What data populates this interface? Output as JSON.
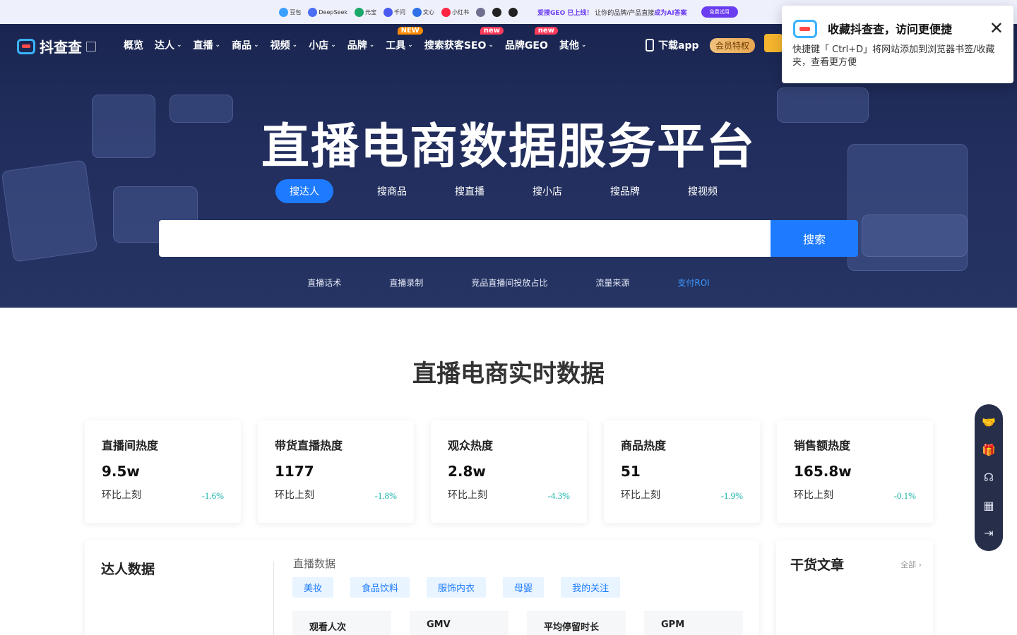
{
  "promo": {
    "ai_chips": [
      {
        "name": "豆包",
        "color": "#3aa0ff"
      },
      {
        "name": "DeepSeek",
        "color": "#4c6ef5"
      },
      {
        "name": "元宝",
        "color": "#1aa86b"
      },
      {
        "name": "千问",
        "color": "#4a5cf0"
      },
      {
        "name": "文心",
        "color": "#2f6fe8"
      },
      {
        "name": "小红书",
        "color": "#ff2442"
      },
      {
        "name": "",
        "color": "#6f6f8f"
      },
      {
        "name": "",
        "color": "#222222"
      },
      {
        "name": "",
        "color": "#222222"
      }
    ],
    "headline_highlight": "爱搜GEO 已上线！",
    "headline_rest": "让你的品牌/产品直接",
    "headline_em": "成为AI答案",
    "trial_label": "免费试用"
  },
  "nav": {
    "logo_text": "抖查查",
    "items": [
      {
        "label": "概览",
        "chevron": false,
        "badge": ""
      },
      {
        "label": "达人",
        "chevron": true,
        "badge": ""
      },
      {
        "label": "直播",
        "chevron": true,
        "badge": ""
      },
      {
        "label": "商品",
        "chevron": true,
        "badge": ""
      },
      {
        "label": "视频",
        "chevron": true,
        "badge": ""
      },
      {
        "label": "小店",
        "chevron": true,
        "badge": ""
      },
      {
        "label": "品牌",
        "chevron": true,
        "badge": ""
      },
      {
        "label": "工具",
        "chevron": true,
        "badge": "NEW"
      },
      {
        "label": "搜索获客SEO",
        "chevron": true,
        "badge": "new"
      },
      {
        "label": "品牌GEO",
        "chevron": false,
        "badge": "new"
      },
      {
        "label": "其他",
        "chevron": true,
        "badge": ""
      }
    ],
    "download_label": "下载app",
    "vip_label": "会员特权"
  },
  "hero": {
    "title": "直播电商数据服务平台",
    "tabs": [
      "搜达人",
      "搜商品",
      "搜直播",
      "搜小店",
      "搜品牌",
      "搜视频"
    ],
    "search_placeholder": "",
    "search_button": "搜索",
    "quick_links": [
      "直播话术",
      "直播录制",
      "竞品直播间投放占比",
      "流量来源",
      "支付ROI"
    ]
  },
  "favorite_popup": {
    "title": "收藏抖查查，访问更便捷",
    "desc": "快捷键「 Ctrl+D」将网站添加到浏览器书签/收藏夹，查看更方便"
  },
  "realtime": {
    "title": "直播电商实时数据",
    "cards": [
      {
        "title": "直播间热度",
        "value": "9.5w",
        "label": "环比上刻",
        "change": "-1.6%"
      },
      {
        "title": "带货直播热度",
        "value": "1177",
        "label": "环比上刻",
        "change": "-1.8%"
      },
      {
        "title": "观众热度",
        "value": "2.8w",
        "label": "环比上刻",
        "change": "-4.3%"
      },
      {
        "title": "商品热度",
        "value": "51",
        "label": "环比上刻",
        "change": "-1.9%"
      },
      {
        "title": "销售额热度",
        "value": "165.8w",
        "label": "环比上刻",
        "change": "-0.1%"
      }
    ]
  },
  "talent_panel": {
    "title": "达人数据",
    "sub": "直播数据",
    "chips": [
      "美妆",
      "食品饮料",
      "服饰内衣",
      "母婴",
      "我的关注"
    ],
    "columns": [
      "观看人次",
      "GMV",
      "平均停留时长",
      "GPM"
    ]
  },
  "articles": {
    "title": "干货文章",
    "all": "全部"
  },
  "side_icons": [
    "handshake-icon",
    "gift-icon",
    "headset-icon",
    "qrcode-icon",
    "exit-icon"
  ]
}
